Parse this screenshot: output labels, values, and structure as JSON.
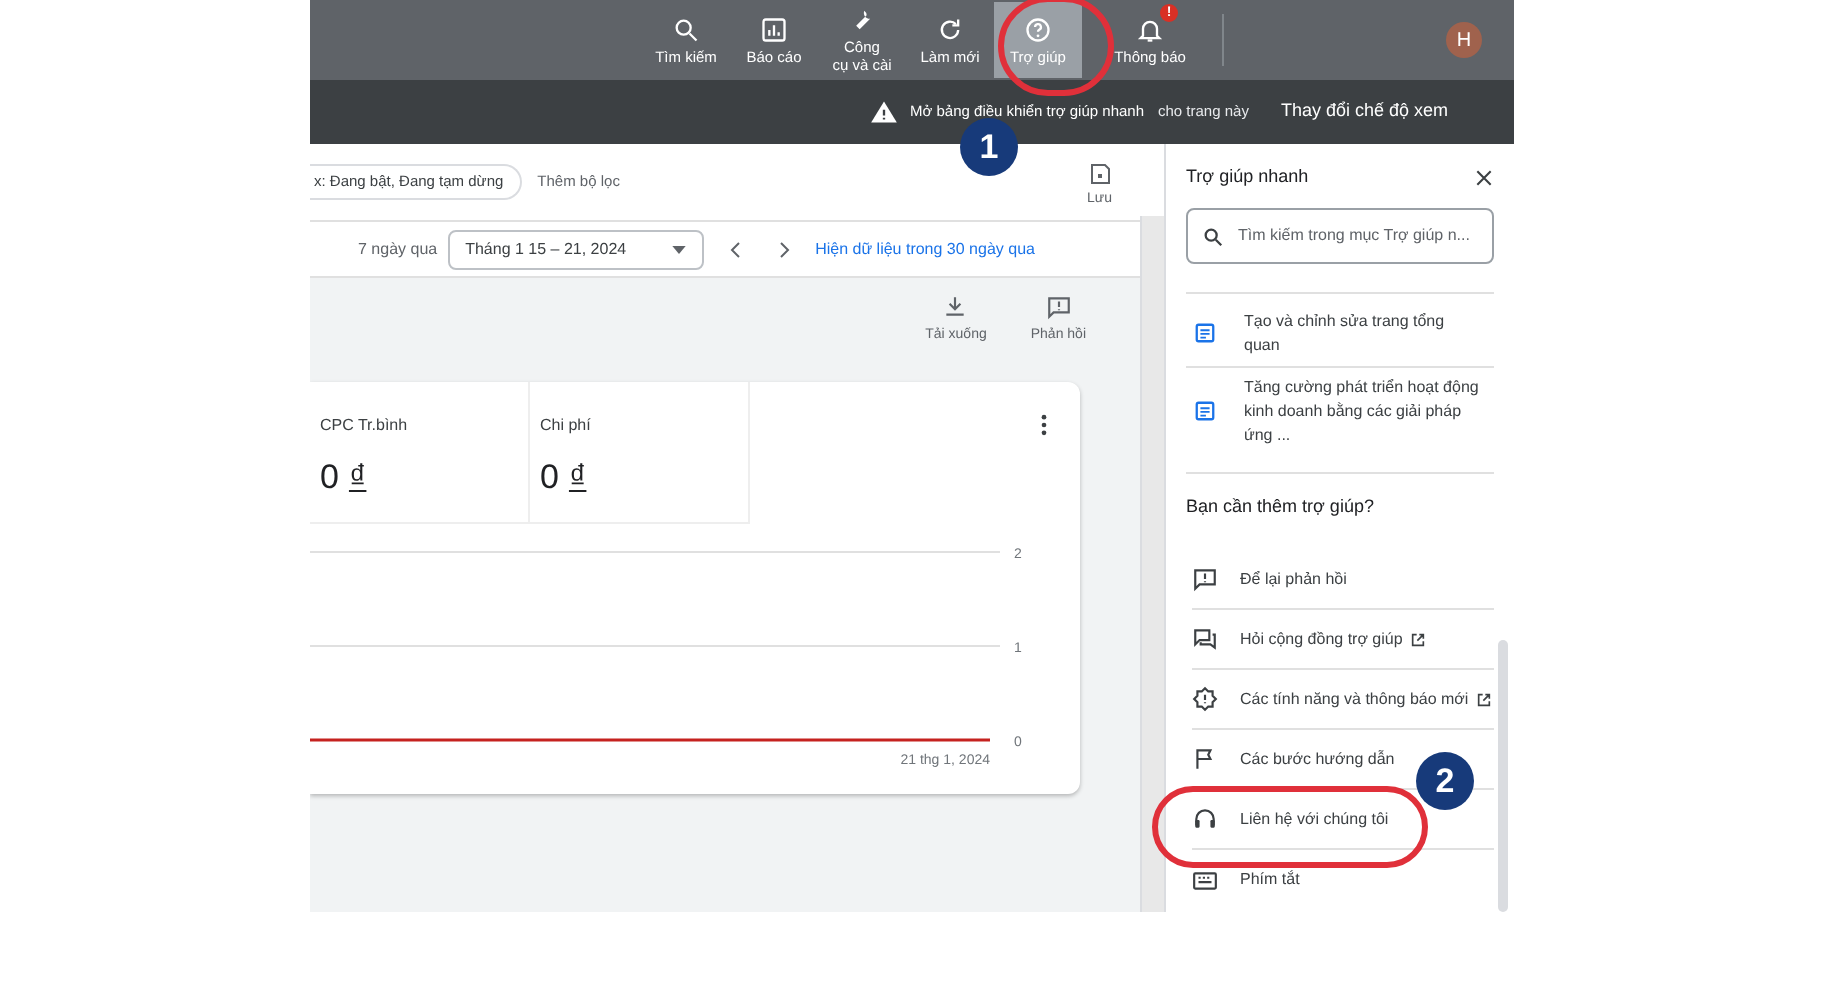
{
  "top_bar": {
    "items": [
      {
        "kind": "search",
        "label": "Tìm kiếm",
        "selected": false
      },
      {
        "kind": "report",
        "label": "Báo cáo",
        "selected": false
      },
      {
        "kind": "tools",
        "label": "Công\ncụ và cài",
        "selected": false
      },
      {
        "kind": "refresh",
        "label": "Làm mới",
        "selected": false
      },
      {
        "kind": "help",
        "label": "Trợ giúp",
        "selected": true
      },
      {
        "kind": "bell",
        "label": "Thông báo",
        "selected": false,
        "badge": "!"
      }
    ],
    "avatar": "H"
  },
  "sub_bar": {
    "tooltip": "Mở bảng điều khiển trợ giúp nhanh",
    "notice": "cho trang này",
    "view_button": "Thay đổi chế độ xem"
  },
  "filters": {
    "chip": "x: Đang bật, Đang tạm dừng",
    "add_filter": "Thêm bộ lọc",
    "save": "Lưu"
  },
  "date_bar": {
    "range_label": "7 ngày qua",
    "date": "Tháng 1 15 – 21, 2024",
    "link": "Hiện dữ liệu trong 30 ngày qua"
  },
  "actions": [
    {
      "kind": "download",
      "label": "Tải xuống"
    },
    {
      "kind": "feedback",
      "label": "Phản hồi"
    }
  ],
  "metrics": [
    {
      "label": "CPC Tr.bình",
      "value": "0",
      "unit": "₫"
    },
    {
      "label": "Chi phí",
      "value": "0",
      "unit": "₫"
    }
  ],
  "chart": {
    "y_labels": [
      "2",
      "1",
      "0"
    ],
    "date_label": "21 thg 1, 2024"
  },
  "help_panel": {
    "title": "Trợ giúp nhanh",
    "search_placeholder": "Tìm kiếm trong mục Trợ giúp n...",
    "articles": [
      "Tạo và chỉnh sửa trang tổng quan",
      "Tăng cường phát triển hoạt động kinh doanh bằng các giải pháp ứng ..."
    ],
    "more_title": "Bạn cần thêm trợ giúp?",
    "links": [
      {
        "kind": "feedback",
        "label": "Để lại phản hồi",
        "external": false
      },
      {
        "kind": "forum",
        "label": "Hỏi cộng đồng trợ giúp",
        "external": true
      },
      {
        "kind": "news",
        "label": "Các tính năng và thông báo mới",
        "external": true
      },
      {
        "kind": "flag",
        "label": "Các bước hướng dẫn",
        "external": false
      },
      {
        "kind": "headset",
        "label": "Liên hệ với chúng tôi",
        "external": false
      },
      {
        "kind": "keyboard",
        "label": "Phím tắt",
        "external": false
      }
    ]
  },
  "annotations": [
    "1",
    "2"
  ]
}
